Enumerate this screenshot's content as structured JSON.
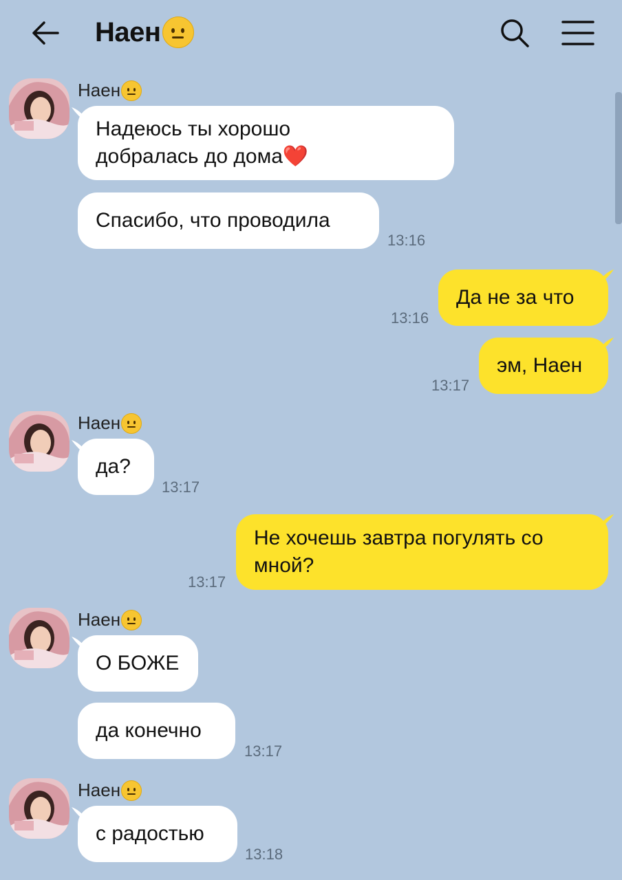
{
  "header": {
    "title": "Наен",
    "title_emoji": "neutral-face-emoji",
    "back_icon": "back-arrow-icon",
    "search_icon": "search-icon",
    "menu_icon": "menu-icon"
  },
  "colors": {
    "background": "#b2c7de",
    "incoming_bubble": "#ffffff",
    "outgoing_bubble": "#fde22b",
    "timestamp": "#5b6b7c"
  },
  "messages": [
    {
      "direction": "in",
      "sender": "Наен",
      "texts": [
        "Надеюсь ты хорошо добралась до дома❤️",
        "Спасибо, что проводила"
      ],
      "time": "13:16"
    },
    {
      "direction": "out",
      "texts": [
        "Да не за что"
      ],
      "time": "13:16"
    },
    {
      "direction": "out",
      "texts": [
        "эм, Наен"
      ],
      "time": "13:17"
    },
    {
      "direction": "in",
      "sender": "Наен",
      "texts": [
        "да?"
      ],
      "time": "13:17"
    },
    {
      "direction": "out",
      "texts": [
        "Не хочешь завтра погулять со мной?"
      ],
      "time": "13:17"
    },
    {
      "direction": "in",
      "sender": "Наен",
      "texts": [
        "О БОЖЕ",
        "да конечно"
      ],
      "time": "13:17"
    },
    {
      "direction": "in",
      "sender": "Наен",
      "texts": [
        "с радостью"
      ],
      "time": "13:18"
    }
  ]
}
